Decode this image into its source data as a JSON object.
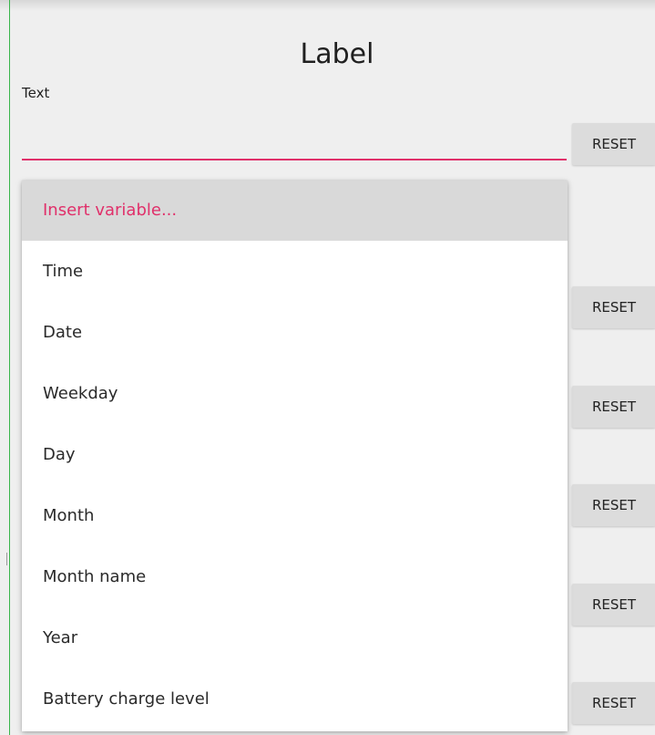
{
  "dialog": {
    "title": "Label"
  },
  "field": {
    "label": "Text",
    "value": "",
    "placeholder": ""
  },
  "reset_buttons": [
    {
      "label": "RESET"
    },
    {
      "label": "RESET"
    },
    {
      "label": "RESET"
    },
    {
      "label": "RESET"
    },
    {
      "label": "RESET"
    },
    {
      "label": "RESET"
    }
  ],
  "insert_menu": {
    "header": "Insert variable...",
    "items": [
      {
        "label": "Time"
      },
      {
        "label": "Date"
      },
      {
        "label": "Weekday"
      },
      {
        "label": "Day"
      },
      {
        "label": "Month"
      },
      {
        "label": "Month name"
      },
      {
        "label": "Year"
      },
      {
        "label": "Battery charge level"
      }
    ]
  },
  "colors": {
    "accent": "#e0306a",
    "background": "#efefef",
    "button": "#dcdcdc",
    "menu_header": "#d9d9d9",
    "window_edge": "#39b54a"
  }
}
